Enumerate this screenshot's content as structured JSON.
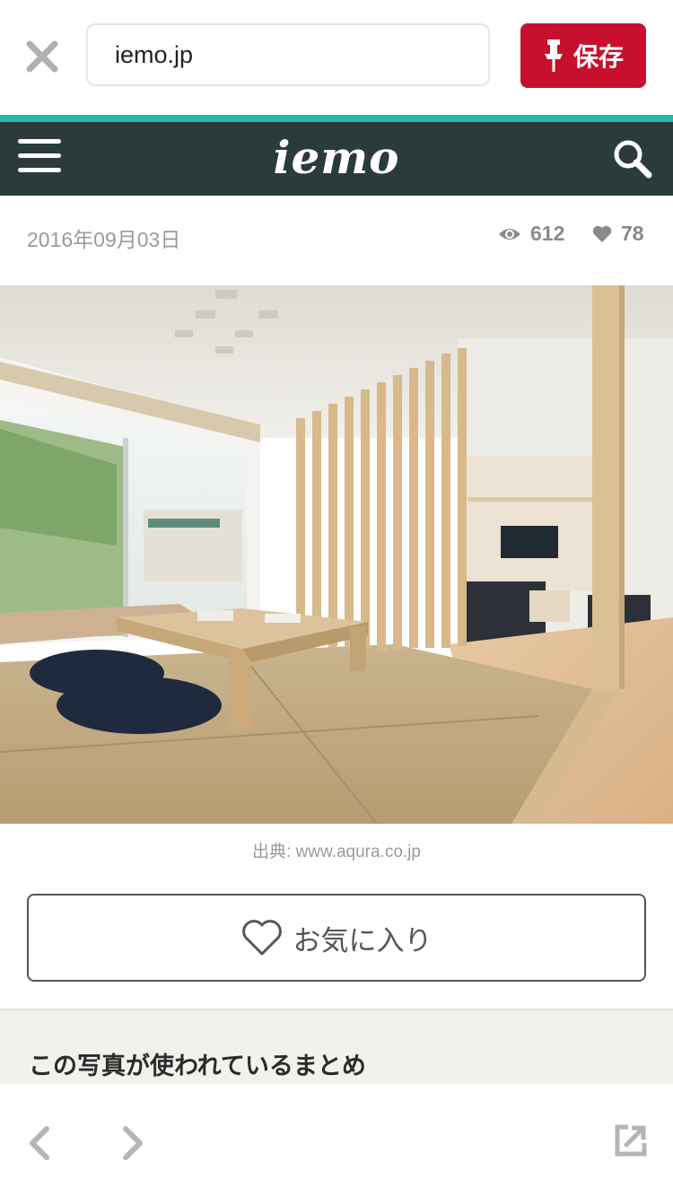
{
  "topbar": {
    "url": "iemo.jp",
    "save_label": "保存",
    "close_icon": "close-icon",
    "pin_icon": "pin-icon"
  },
  "site": {
    "logo": "iemo",
    "brand_color": "#2b3b3b",
    "accent_color": "#2ab4ad"
  },
  "article": {
    "date": "2016年09月03日",
    "views": "612",
    "likes": "78"
  },
  "photo": {
    "credit": "出典: www.aqura.co.jp"
  },
  "favorite_button": {
    "label": "お気に入り"
  },
  "related": {
    "title": "この写真が使われているまとめ"
  },
  "colors": {
    "save_button": "#c8102e",
    "related_bg": "#f2f1ec"
  }
}
